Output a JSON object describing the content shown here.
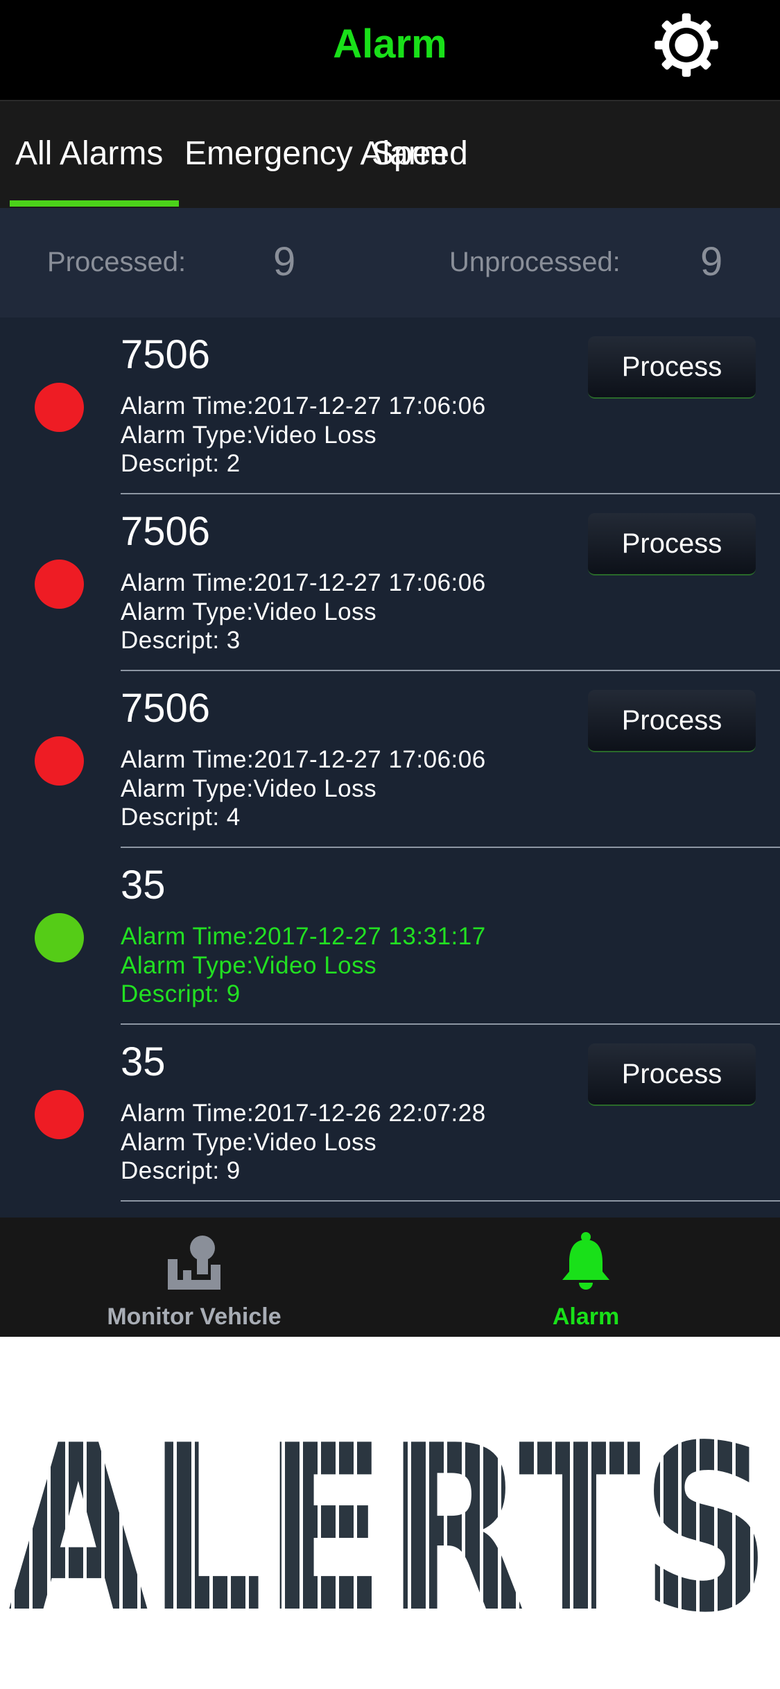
{
  "header": {
    "title": "Alarm",
    "settings_icon": "gear-icon"
  },
  "tabs": [
    {
      "label": "All Alarms",
      "active": true
    },
    {
      "label": "Emergency Alarm",
      "active": false
    },
    {
      "label": "Speed",
      "active": false
    }
  ],
  "summary": {
    "processed_label": "Processed:",
    "processed_value": "9",
    "unprocessed_label": "Unprocessed:",
    "unprocessed_value": "9"
  },
  "alarms": [
    {
      "id": "7506",
      "time": "Alarm Time:2017-12-27 17:06:06",
      "type": "Alarm Type:Video Loss",
      "descript": "Descript:  2",
      "status": "unprocessed",
      "button": "Process"
    },
    {
      "id": "7506",
      "time": "Alarm Time:2017-12-27 17:06:06",
      "type": "Alarm Type:Video Loss",
      "descript": "Descript:  3",
      "status": "unprocessed",
      "button": "Process"
    },
    {
      "id": "7506",
      "time": "Alarm Time:2017-12-27 17:06:06",
      "type": "Alarm Type:Video Loss",
      "descript": "Descript:  4",
      "status": "unprocessed",
      "button": "Process"
    },
    {
      "id": "35",
      "time": "Alarm Time:2017-12-27 13:31:17",
      "type": "Alarm Type:Video Loss",
      "descript": "Descript:  9",
      "status": "processed",
      "button": ""
    },
    {
      "id": "35",
      "time": "Alarm Time:2017-12-26 22:07:28",
      "type": "Alarm Type:Video Loss",
      "descript": "Descript:  9",
      "status": "unprocessed",
      "button": "Process"
    }
  ],
  "bottom_nav": [
    {
      "label": "Monitor Vehicle",
      "icon": "monitor-vehicle-icon",
      "active": false
    },
    {
      "label": "Alarm",
      "icon": "bell-icon",
      "active": true
    }
  ],
  "banner": {
    "text": "ALERTS"
  },
  "colors": {
    "accent_green": "#19e019",
    "unprocessed_red": "#ee1c24",
    "processed_green": "#55cc17",
    "list_bg": "#1a2332",
    "inactive_gray": "#8a8f99"
  }
}
